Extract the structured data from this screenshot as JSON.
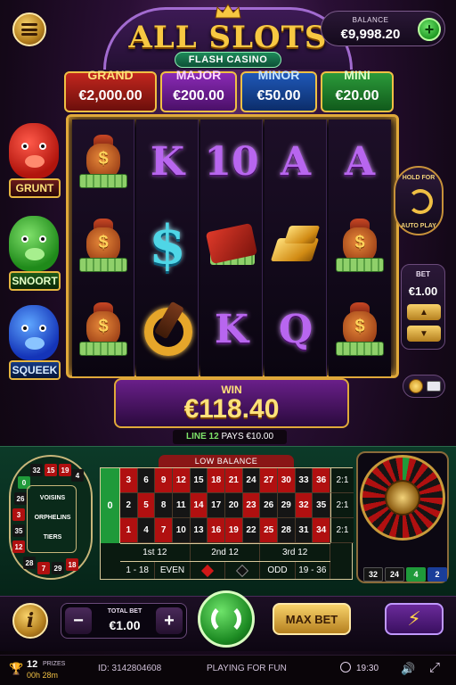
{
  "header": {
    "title": "ALL SLOTS",
    "subtitle": "FLASH CASINO",
    "balance_label": "BALANCE",
    "balance_value": "€9,998.20",
    "add_funds": "+"
  },
  "jackpots": [
    {
      "label": "GRAND",
      "value": "€2,000.00"
    },
    {
      "label": "MAJOR",
      "value": "€200.00"
    },
    {
      "label": "MINOR",
      "value": "€50.00"
    },
    {
      "label": "MINI",
      "value": "€20.00"
    }
  ],
  "characters": [
    "GRUNT",
    "SNOORT",
    "SQUEEK"
  ],
  "reels": [
    [
      "money-bag",
      "money-bag",
      "money-bag"
    ],
    [
      "K",
      "dollar-sign",
      "horseshoe"
    ],
    [
      "10",
      "wallet",
      "K"
    ],
    [
      "A",
      "gold-bars",
      "Q"
    ],
    [
      "A",
      "money-bag",
      "money-bag"
    ]
  ],
  "symbols": {
    "dollar": "$",
    "bag_dollar": "$"
  },
  "autoplay": {
    "line1": "HOLD FOR",
    "line2": "AUTO PLAY"
  },
  "bet": {
    "label": "BET",
    "value": "€1.00",
    "up": "▲",
    "down": "▼"
  },
  "win": {
    "label": "WIN",
    "value": "€118.40",
    "line_label": "LINE 12",
    "line_pays": "PAYS €10.00"
  },
  "roulette": {
    "low_balance": "LOW BALANCE",
    "zero": "0",
    "rows": [
      [
        "3",
        "6",
        "9",
        "12",
        "15",
        "18",
        "21",
        "24",
        "27",
        "30",
        "33",
        "36"
      ],
      [
        "2",
        "5",
        "8",
        "11",
        "14",
        "17",
        "20",
        "23",
        "26",
        "29",
        "32",
        "35"
      ],
      [
        "1",
        "4",
        "7",
        "10",
        "13",
        "16",
        "19",
        "22",
        "25",
        "28",
        "31",
        "34"
      ]
    ],
    "row_colors": [
      [
        "red",
        "black",
        "red",
        "red",
        "black",
        "red",
        "red",
        "black",
        "red",
        "red",
        "black",
        "red"
      ],
      [
        "black",
        "red",
        "black",
        "black",
        "red",
        "black",
        "black",
        "red",
        "black",
        "black",
        "red",
        "black"
      ],
      [
        "red",
        "black",
        "red",
        "black",
        "black",
        "red",
        "red",
        "black",
        "red",
        "black",
        "black",
        "red"
      ]
    ],
    "columns": [
      "2:1",
      "2:1",
      "2:1"
    ],
    "dozens": [
      "1st 12",
      "2nd 12",
      "3rd 12"
    ],
    "outside": [
      "1 - 18",
      "EVEN",
      "",
      "",
      "ODD",
      "19 - 36"
    ],
    "race_numbers": [
      "32",
      "15",
      "19",
      "4",
      "0",
      "26",
      "3",
      "35",
      "12",
      "28",
      "7",
      "29",
      "18"
    ],
    "race_sections": [
      "VOISINS",
      "ORPHELINS",
      "TIERS"
    ],
    "history": [
      "32",
      "24",
      "4",
      "2"
    ]
  },
  "controls": {
    "info": "i",
    "total_bet_label": "TOTAL BET",
    "total_bet_value": "€1.00",
    "minus": "−",
    "plus": "+",
    "max_bet": "MAX BET",
    "turbo": "⚡"
  },
  "status": {
    "prizes_count": "12",
    "prizes_label": "PRIZES",
    "prizes_time": "00h 28m",
    "session_id": "ID: 3142804608",
    "mode": "PLAYING FOR FUN",
    "clock": "19:30"
  },
  "colors": {
    "gold": "#f0c044",
    "red": "#b01010",
    "green": "#1f9a3a",
    "purple": "#6a1f8a"
  }
}
